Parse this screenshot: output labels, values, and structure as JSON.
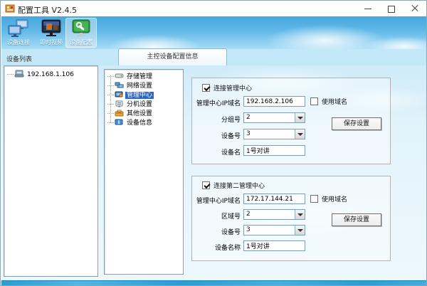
{
  "window": {
    "title": "配置工具 V2.4.5"
  },
  "titlebar": {
    "buttons": [
      "minimize",
      "maximize",
      "close"
    ]
  },
  "toolbar": {
    "buttons": [
      {
        "label": "设备连接",
        "icon": "device-connect-icon",
        "selected": false
      },
      {
        "label": "即时视频",
        "icon": "live-video-icon",
        "selected": false
      },
      {
        "label": "设备配置",
        "icon": "device-config-icon",
        "selected": true
      }
    ]
  },
  "left_panel": {
    "header": "设备列表",
    "tree": [
      {
        "label": "192.168.1.106",
        "icon": "device-node-icon"
      }
    ]
  },
  "tab": {
    "label": "主控设备配置信息",
    "selected": true
  },
  "settings_tree": {
    "items": [
      {
        "label": "存储管理",
        "icon": "storage-icon",
        "selected": false
      },
      {
        "label": "网络设置",
        "icon": "network-icon",
        "selected": false
      },
      {
        "label": "管理中心",
        "icon": "mgmt-center-icon",
        "selected": true
      },
      {
        "label": "分机设置",
        "icon": "extension-icon",
        "selected": false
      },
      {
        "label": "其他设置",
        "icon": "other-settings-icon",
        "selected": false
      },
      {
        "label": "设备信息",
        "icon": "device-info-icon",
        "selected": false
      }
    ]
  },
  "center1": {
    "connect_label": "连接管理中心",
    "connect_checked": true,
    "ip_label": "管理中心IP域名",
    "ip_value": "192.168.2.106",
    "use_domain_label": "使用域名",
    "use_domain_checked": false,
    "group_label": "分组号",
    "group_value": "2",
    "device_no_label": "设备号",
    "device_no_value": "3",
    "device_name_label": "设备名",
    "device_name_value": "1号对讲",
    "save_label": "保存设置"
  },
  "center2": {
    "connect_label": "连接第二管理中心",
    "connect_checked": true,
    "ip_label": "管理中心IP域名",
    "ip_value": "172.17.144.21",
    "use_domain_label": "使用域名",
    "use_domain_checked": false,
    "region_label": "区域号",
    "region_value": "2",
    "device_no_label": "设备号",
    "device_no_value": "3",
    "device_name_label": "设备名称",
    "device_name_value": "1号对讲",
    "save_label": "保存设置"
  },
  "colors": {
    "selection_blue": "#2A66C9",
    "toolbar_top": "#45A7DD",
    "toolbar_bottom": "#A9DDF5",
    "band_blue": "#C3E8F7",
    "statusbar_blue": "#2D9BD1"
  }
}
